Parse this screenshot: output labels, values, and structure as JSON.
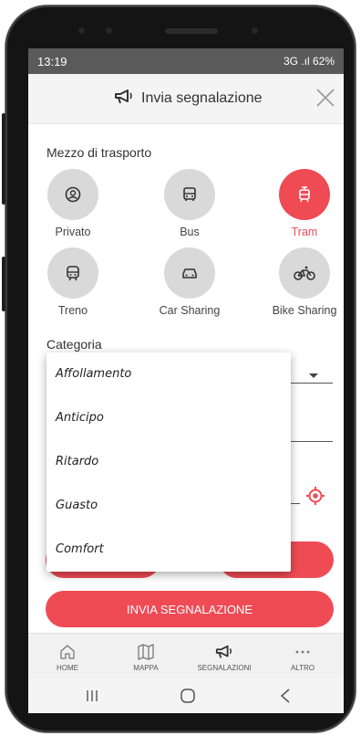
{
  "status_bar": {
    "time": "13:19",
    "indicators": "3G .ıl 62%"
  },
  "header": {
    "title": "Invia segnalazione",
    "icon": "megaphone-icon",
    "close_icon": "close-icon"
  },
  "transport": {
    "label": "Mezzo di trasporto",
    "options": [
      {
        "label": "Privato",
        "icon": "user-circle-icon",
        "selected": false
      },
      {
        "label": "Bus",
        "icon": "bus-icon",
        "selected": false
      },
      {
        "label": "Tram",
        "icon": "tram-icon",
        "selected": true
      },
      {
        "label": "Treno",
        "icon": "train-icon",
        "selected": false
      },
      {
        "label": "Car Sharing",
        "icon": "car-icon",
        "selected": false
      },
      {
        "label": "Bike Sharing",
        "icon": "bike-icon",
        "selected": false
      }
    ]
  },
  "category": {
    "label": "Categoria",
    "options": [
      "Affollamento",
      "Anticipo",
      "Ritardo",
      "Guasto",
      "Comfort"
    ]
  },
  "submit_label": "INVIA SEGNALAZIONE",
  "bottom_nav": [
    {
      "label": "HOME",
      "icon": "home-icon"
    },
    {
      "label": "MAPPA",
      "icon": "map-icon"
    },
    {
      "label": "SEGNALAZIONI",
      "icon": "megaphone-icon"
    },
    {
      "label": "ALTRO",
      "icon": "more-icon"
    }
  ],
  "colors": {
    "accent": "#ee4b55",
    "unselected": "#d9d9d9"
  }
}
